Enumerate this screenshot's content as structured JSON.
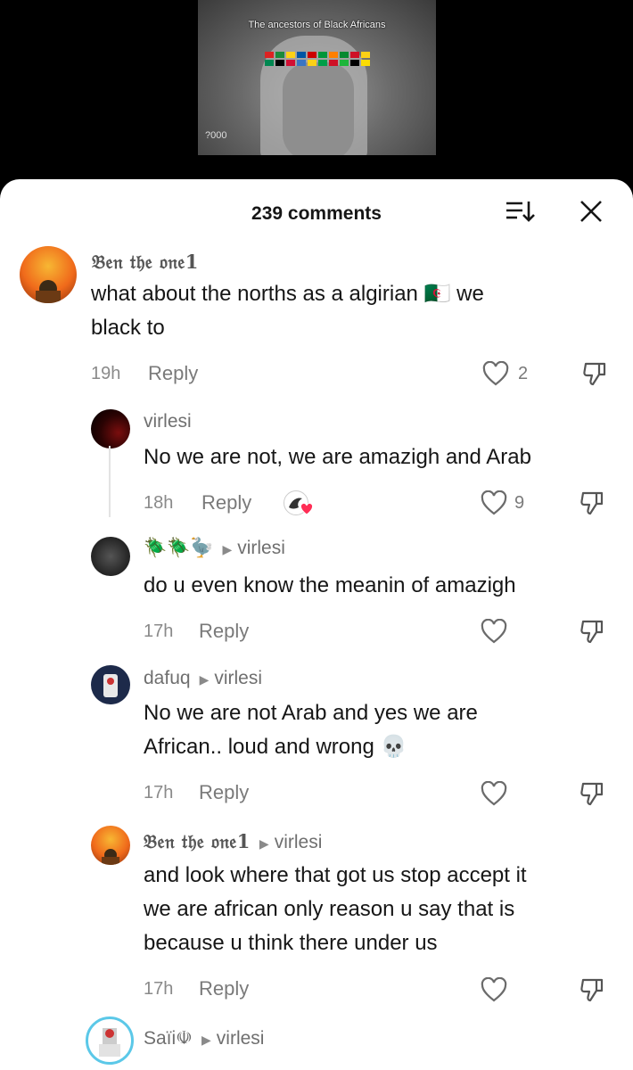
{
  "video": {
    "caption": "The ancestors of Black Africans",
    "bottom_text": "?000"
  },
  "header": {
    "comment_count": "239 comments"
  },
  "comments": [
    {
      "name": "𝔅𝔢𝔫 𝔱𝔥𝔢 𝔬𝔫𝔢1",
      "text1": "what about the norths as a algirian 🇩🇿  we",
      "text2": "black to",
      "time": "19h",
      "reply": "Reply",
      "likes": "2"
    },
    {
      "name": "virlesi",
      "text1": "No we are not, we are amazigh and Arab",
      "time": "18h",
      "reply": "Reply",
      "likes": "9"
    },
    {
      "name": "🪲🪲🦤",
      "reply_to": "virlesi",
      "text1": "do u even know the meanin of amazigh",
      "time": "17h",
      "reply": "Reply"
    },
    {
      "name": "dafuq",
      "reply_to": "virlesi",
      "text1": "No we are not Arab and yes we are",
      "text2": "African.. loud and wrong 💀",
      "time": "17h",
      "reply": "Reply"
    },
    {
      "name": "𝔅𝔢𝔫 𝔱𝔥𝔢 𝔬𝔫𝔢1",
      "reply_to": "virlesi",
      "text1": "and look where that got us stop accept it",
      "text2": "we are african only reason u say that is",
      "text3": "because u think there under us",
      "time": "17h",
      "reply": "Reply"
    },
    {
      "name": "Saïi☫",
      "reply_to": "virlesi"
    }
  ],
  "colors": {
    "heart_liked": "#ff2d55",
    "sheet": "#ffffff"
  }
}
